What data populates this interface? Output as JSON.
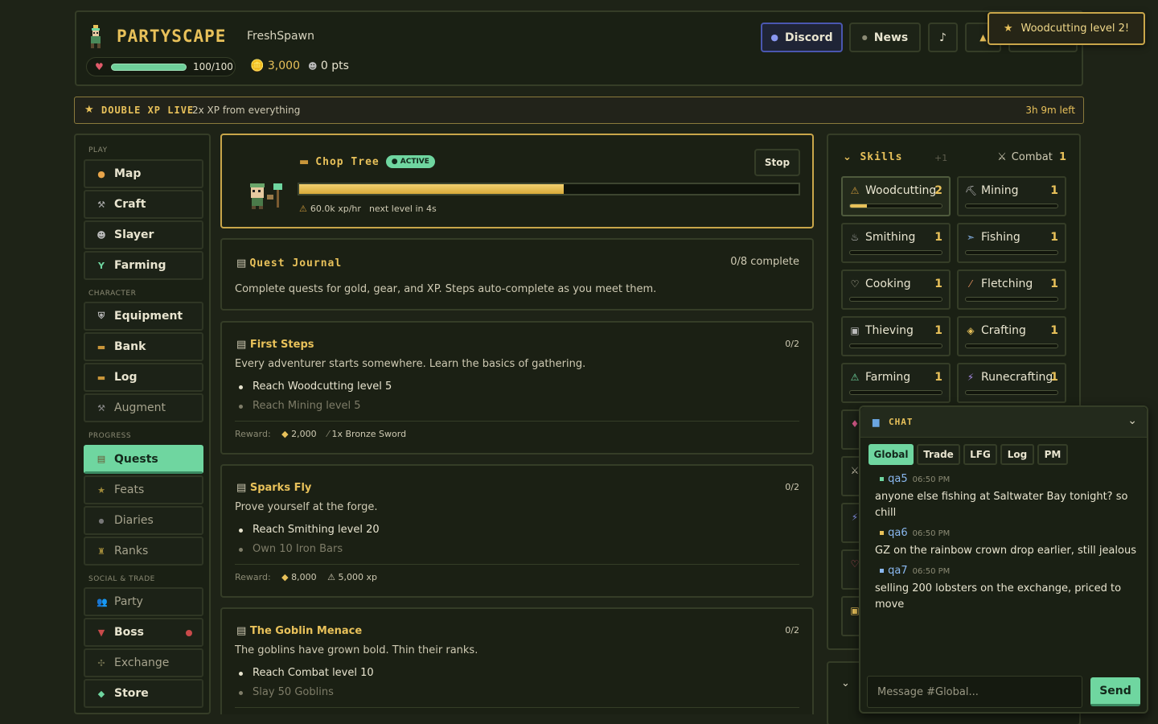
{
  "header": {
    "logo": "PARTYSCAPE",
    "username": "FreshSpawn",
    "hp": "100/100",
    "hp_fraction": 1.0,
    "gold": "3,000",
    "points": "0 pts",
    "discord_label": "Discord",
    "news_label": "News",
    "music_icon": "music-note-icon",
    "bell_icon": "bell-icon"
  },
  "toast": {
    "text": "Woodcutting level 2!"
  },
  "banner": {
    "title": "DOUBLE XP LIVE",
    "text": "2x XP from everything",
    "time_left": "3h 9m left"
  },
  "sidebar": {
    "sections": [
      "PLAY",
      "CHARACTER",
      "PROGRESS",
      "SOCIAL & TRADE"
    ],
    "items": [
      {
        "label": "Map"
      },
      {
        "label": "Craft"
      },
      {
        "label": "Slayer"
      },
      {
        "label": "Farming"
      },
      {
        "label": "Equipment"
      },
      {
        "label": "Bank"
      },
      {
        "label": "Log"
      },
      {
        "label": "Augment"
      },
      {
        "label": "Quests"
      },
      {
        "label": "Feats"
      },
      {
        "label": "Diaries"
      },
      {
        "label": "Ranks"
      },
      {
        "label": "Party"
      },
      {
        "label": "Boss"
      },
      {
        "label": "Exchange"
      },
      {
        "label": "Store"
      }
    ]
  },
  "action": {
    "title": "Chop Tree",
    "badge": "ACTIVE",
    "stop_label": "Stop",
    "progress_fraction": 0.53,
    "xp_rate": "60.0k xp/hr",
    "next_level": "next level in 4s"
  },
  "journal": {
    "title": "Quest Journal",
    "count": "0/8 complete",
    "desc": "Complete quests for gold, gear, and XP. Steps auto-complete as you meet them."
  },
  "quests": [
    {
      "title": "First Steps",
      "count": "0/2",
      "desc": "Every adventurer starts somewhere. Learn the basics of gathering.",
      "steps": [
        "Reach Woodcutting level 5",
        "Reach Mining level 5"
      ],
      "reward_label": "Reward:",
      "reward_gold": "2,000",
      "reward_item": "1x Bronze Sword"
    },
    {
      "title": "Sparks Fly",
      "count": "0/2",
      "desc": "Prove yourself at the forge.",
      "steps": [
        "Reach Smithing level 20",
        "Own 10 Iron Bars"
      ],
      "reward_label": "Reward:",
      "reward_gold": "8,000",
      "reward_item": "5,000 xp"
    },
    {
      "title": "The Goblin Menace",
      "count": "0/2",
      "desc": "The goblins have grown bold. Thin their ranks.",
      "steps": [
        "Reach Combat level 10",
        "Slay 50 Goblins"
      ]
    }
  ],
  "skills": {
    "title": "Skills",
    "plus": "+1",
    "combat_label": "Combat",
    "combat_level": "1",
    "list": [
      {
        "name": "Woodcutting",
        "level": "2",
        "progress": 0.18
      },
      {
        "name": "Mining",
        "level": "1",
        "progress": 0
      },
      {
        "name": "Smithing",
        "level": "1",
        "progress": 0
      },
      {
        "name": "Fishing",
        "level": "1",
        "progress": 0
      },
      {
        "name": "Cooking",
        "level": "1",
        "progress": 0
      },
      {
        "name": "Fletching",
        "level": "1",
        "progress": 0
      },
      {
        "name": "Thieving",
        "level": "1",
        "progress": 0
      },
      {
        "name": "Crafting",
        "level": "1",
        "progress": 0
      },
      {
        "name": "Farming",
        "level": "1",
        "progress": 0
      },
      {
        "name": "Runecrafting",
        "level": "1",
        "progress": 0
      }
    ]
  },
  "chat": {
    "title": "CHAT",
    "tabs": [
      "Global",
      "Trade",
      "LFG",
      "Log",
      "PM"
    ],
    "messages": [
      {
        "user": "qa5",
        "time": "06:50 PM",
        "text": "anyone else fishing at Saltwater Bay tonight? so chill",
        "color": "#6fd6a0"
      },
      {
        "user": "qa6",
        "time": "06:50 PM",
        "text": "GZ on the rainbow crown drop earlier, still jealous",
        "color": "#e8c15a"
      },
      {
        "user": "qa7",
        "time": "06:50 PM",
        "text": "selling 200 lobsters on the exchange, priced to move",
        "color": "#8ab8f0"
      }
    ],
    "placeholder": "Message #Global...",
    "send_label": "Send"
  },
  "colors": {
    "accent_gold": "#e8c15a",
    "accent_green": "#6fd6a0",
    "discord": "#4a57b0"
  }
}
